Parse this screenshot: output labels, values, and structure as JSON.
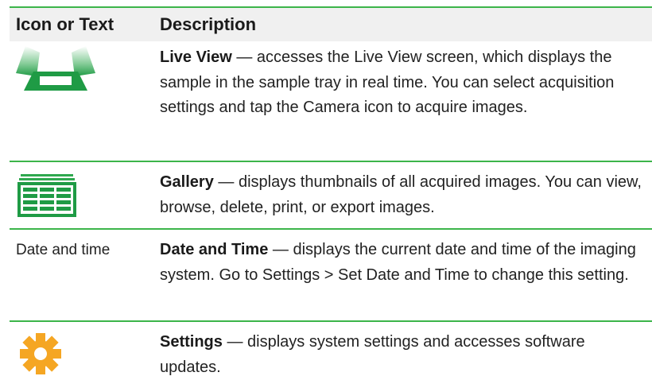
{
  "header": {
    "col_icon": "Icon or Text",
    "col_desc": "Description"
  },
  "rows": [
    {
      "icon": "live-view-icon",
      "title": "Live View",
      "sep": " — ",
      "text": "accesses the Live View screen, which displays the sample in the sample tray in real time. You can select acquisition settings and tap the Camera icon to acquire images."
    },
    {
      "icon": "gallery-icon",
      "title": "Gallery",
      "sep": " — ",
      "text": "displays thumbnails of all acquired images. You can view, browse, delete, print, or export images."
    },
    {
      "label": "Date and time",
      "title": "Date and Time",
      "sep": " — ",
      "text": "displays the current date and time of the imaging system. Go to Settings > Set Date and Time to change this setting."
    },
    {
      "icon": "gear-icon",
      "title": "Settings",
      "sep": " — ",
      "text": "displays system settings and accesses software updates."
    }
  ],
  "colors": {
    "rule": "#3cb54a",
    "header_bg": "#f0f0f0",
    "icon_green": "#2fa84f",
    "gear_orange": "#f5a623"
  }
}
